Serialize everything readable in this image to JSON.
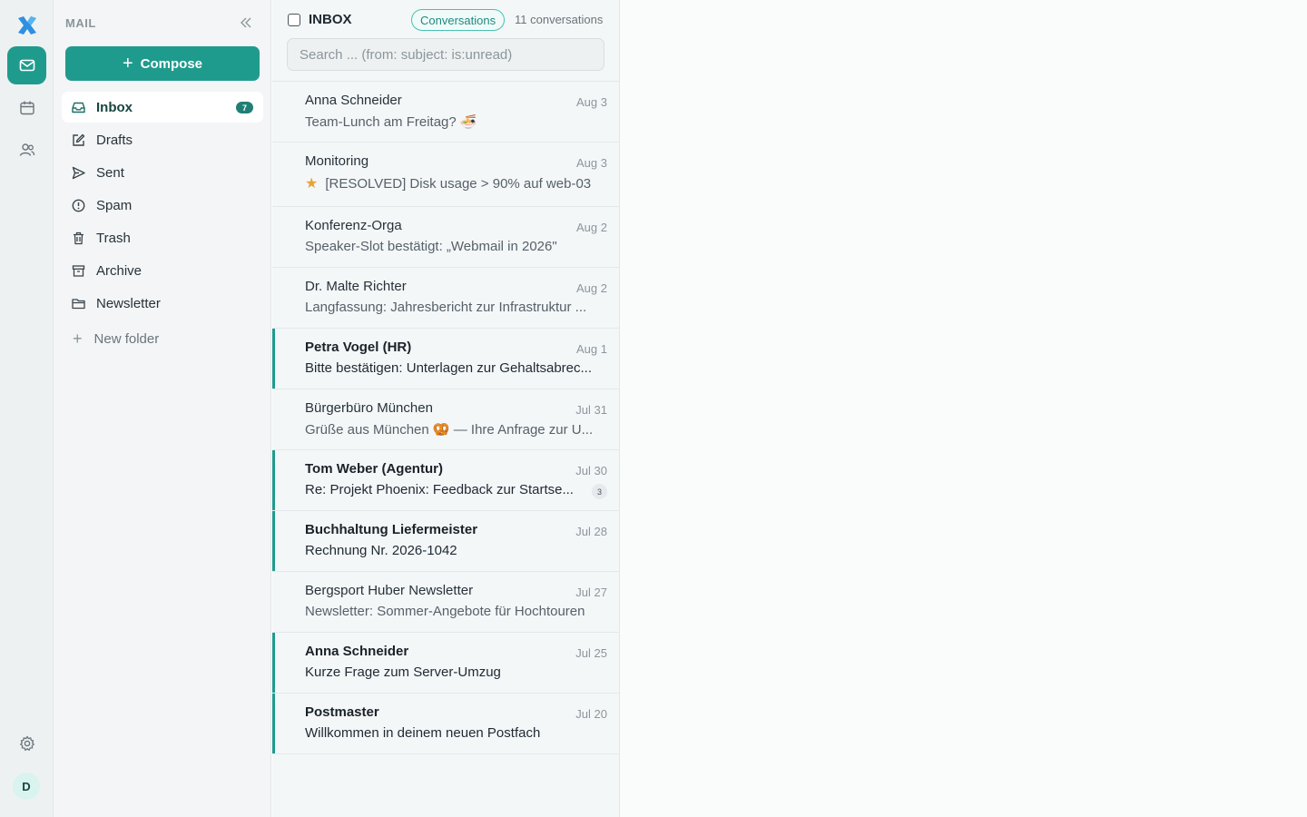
{
  "sidebar": {
    "title": "MAIL",
    "compose_label": "Compose",
    "inbox_badge": "7",
    "folders": [
      {
        "label": "Inbox",
        "icon": "inbox-icon"
      },
      {
        "label": "Drafts",
        "icon": "pencil-icon"
      },
      {
        "label": "Sent",
        "icon": "send-icon"
      },
      {
        "label": "Spam",
        "icon": "alert-circle-icon"
      },
      {
        "label": "Trash",
        "icon": "trash-icon"
      },
      {
        "label": "Archive",
        "icon": "archive-icon"
      },
      {
        "label": "Newsletter",
        "icon": "folder-icon"
      }
    ],
    "new_folder_label": "New folder"
  },
  "rail": {
    "avatar_initial": "D"
  },
  "list": {
    "title": "INBOX",
    "view_pill": "Conversations",
    "count_text": "11 conversations",
    "search_placeholder": "Search ... (from: subject: is:unread)",
    "messages": [
      {
        "sender": "Anna Schneider",
        "date": "Aug 3",
        "subject": "Team-Lunch am Freitag? 🍜"
      },
      {
        "sender": "Monitoring",
        "date": "Aug 3",
        "subject": "[RESOLVED] Disk usage > 90% auf web-03"
      },
      {
        "sender": "Konferenz-Orga",
        "date": "Aug 2",
        "subject": "Speaker-Slot bestätigt: „Webmail in 2026\""
      },
      {
        "sender": "Dr. Malte Richter",
        "date": "Aug 2",
        "subject": "Langfassung: Jahresbericht zur Infrastruktur ..."
      },
      {
        "sender": "Petra Vogel (HR)",
        "date": "Aug 1",
        "subject": "Bitte bestätigen: Unterlagen zur Gehaltsabrec..."
      },
      {
        "sender": "Bürgerbüro München",
        "date": "Jul 31",
        "subject": "Grüße aus München 🥨 — Ihre Anfrage zur U..."
      },
      {
        "sender": "Tom Weber (Agentur)",
        "date": "Jul 30",
        "subject": "Re: Projekt Phoenix: Feedback zur Startse...",
        "thread_count": "3"
      },
      {
        "sender": "Buchhaltung Liefermeister",
        "date": "Jul 28",
        "subject": "Rechnung Nr. 2026-1042"
      },
      {
        "sender": "Bergsport Huber Newsletter",
        "date": "Jul 27",
        "subject": "Newsletter: Sommer-Angebote für Hochtouren"
      },
      {
        "sender": "Anna Schneider",
        "date": "Jul 25",
        "subject": "Kurze Frage zum Server-Umzug"
      },
      {
        "sender": "Postmaster",
        "date": "Jul 20",
        "subject": "Willkommen in deinem neuen Postfach"
      }
    ]
  },
  "colors": {
    "accent": "#1f9b8e",
    "unread_bar": "#1f9b8e",
    "star": "#e7a23a"
  }
}
